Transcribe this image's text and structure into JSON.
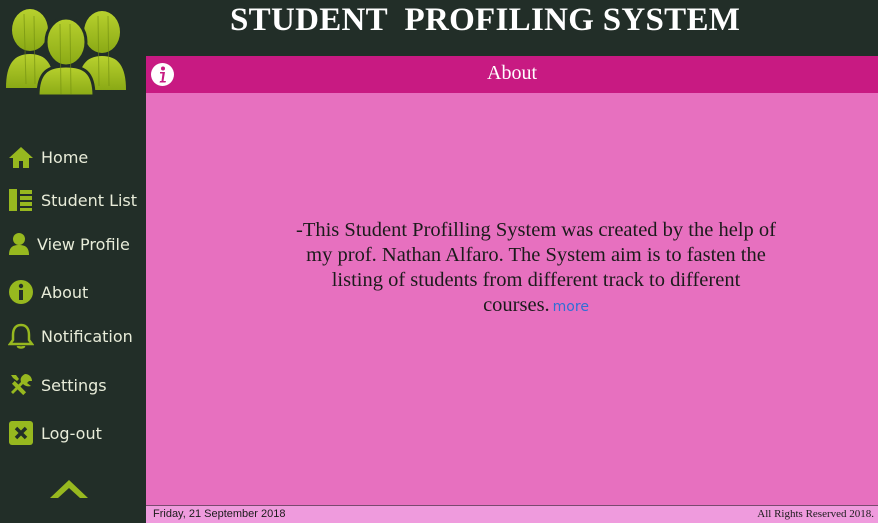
{
  "app": {
    "title": "STUDENT  PROFILING SYSTEM"
  },
  "sidebar": {
    "logo_icon": "users-group-icon",
    "items": [
      {
        "label": "Home",
        "icon": "home-icon"
      },
      {
        "label": "Student List",
        "icon": "list-icon"
      },
      {
        "label": "View Profile",
        "icon": "user-icon"
      },
      {
        "label": "About",
        "icon": "info-icon"
      },
      {
        "label": "Notification",
        "icon": "bell-icon"
      },
      {
        "label": "Settings",
        "icon": "tools-icon"
      },
      {
        "label": "Log-out",
        "icon": "logout-x-icon"
      }
    ],
    "collapse_icon": "chevron-up-icon"
  },
  "page": {
    "title": "About",
    "title_icon": "info-icon",
    "body_text": "-This Student Profilling System was created by the help of my prof. Nathan Alfaro. The System aim is to fasten the listing of students from different track to different courses.",
    "more_link": "more"
  },
  "statusbar": {
    "date": "Friday, 21 September 2018",
    "rights": "All Rights Reserved 2018."
  },
  "colors": {
    "sidebar_bg": "#222e28",
    "accent_green": "#97b81f",
    "title_bar": "#c81a82",
    "content_bg": "#e770bf",
    "status_bg": "#ef9bdd"
  }
}
